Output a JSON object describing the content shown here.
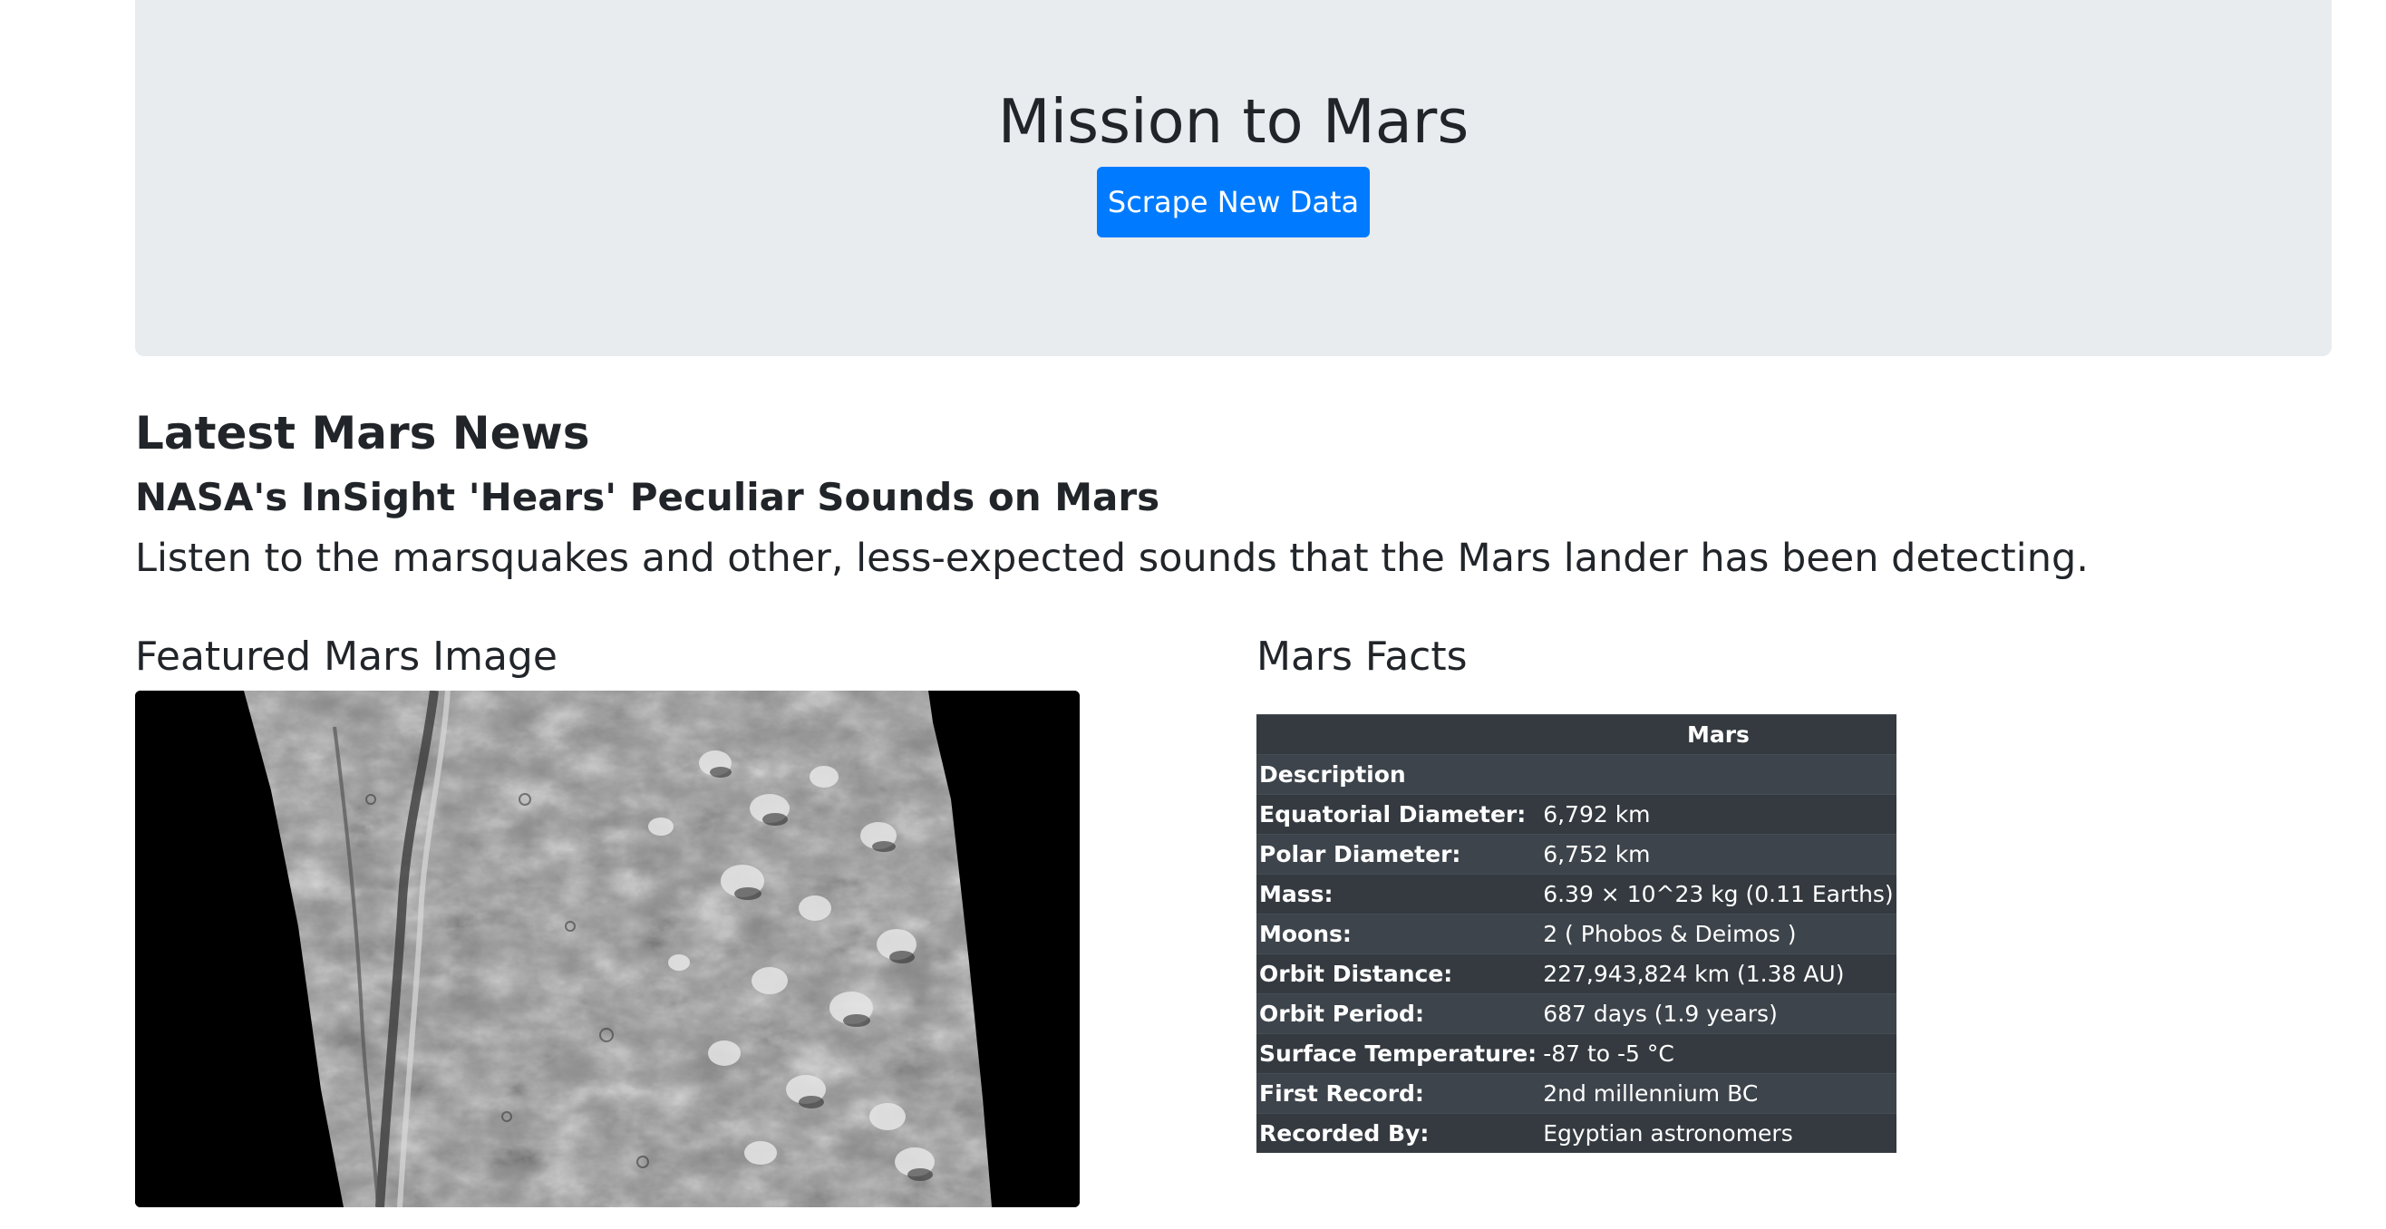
{
  "header": {
    "title": "Mission to Mars",
    "scrape_button_label": "Scrape New Data"
  },
  "news": {
    "section_heading": "Latest Mars News",
    "title": "NASA's InSight 'Hears' Peculiar Sounds on Mars",
    "teaser": "Listen to the marsquakes and other, less-expected sounds that the Mars lander has been detecting."
  },
  "featured_image": {
    "heading": "Featured Mars Image",
    "description": "grayscale orbital image of Martian surface"
  },
  "facts": {
    "heading": "Mars Facts",
    "column_header": "Mars",
    "index_header": "Description",
    "rows": [
      {
        "label": "Equatorial Diameter:",
        "value": "6,792 km"
      },
      {
        "label": "Polar Diameter:",
        "value": "6,752 km"
      },
      {
        "label": "Mass:",
        "value": "6.39 × 10^23 kg (0.11 Earths)"
      },
      {
        "label": "Moons:",
        "value": "2 ( Phobos & Deimos )"
      },
      {
        "label": "Orbit Distance:",
        "value": "227,943,824 km (1.38 AU)"
      },
      {
        "label": "Orbit Period:",
        "value": "687 days (1.9 years)"
      },
      {
        "label": "Surface Temperature:",
        "value": "-87 to -5 °C"
      },
      {
        "label": "First Record:",
        "value": "2nd millennium BC"
      },
      {
        "label": "Recorded By:",
        "value": "Egyptian astronomers"
      }
    ]
  },
  "colors": {
    "primary_button": "#007bff",
    "jumbotron_bg": "#e9ecef",
    "table_dark": "#343a40"
  }
}
